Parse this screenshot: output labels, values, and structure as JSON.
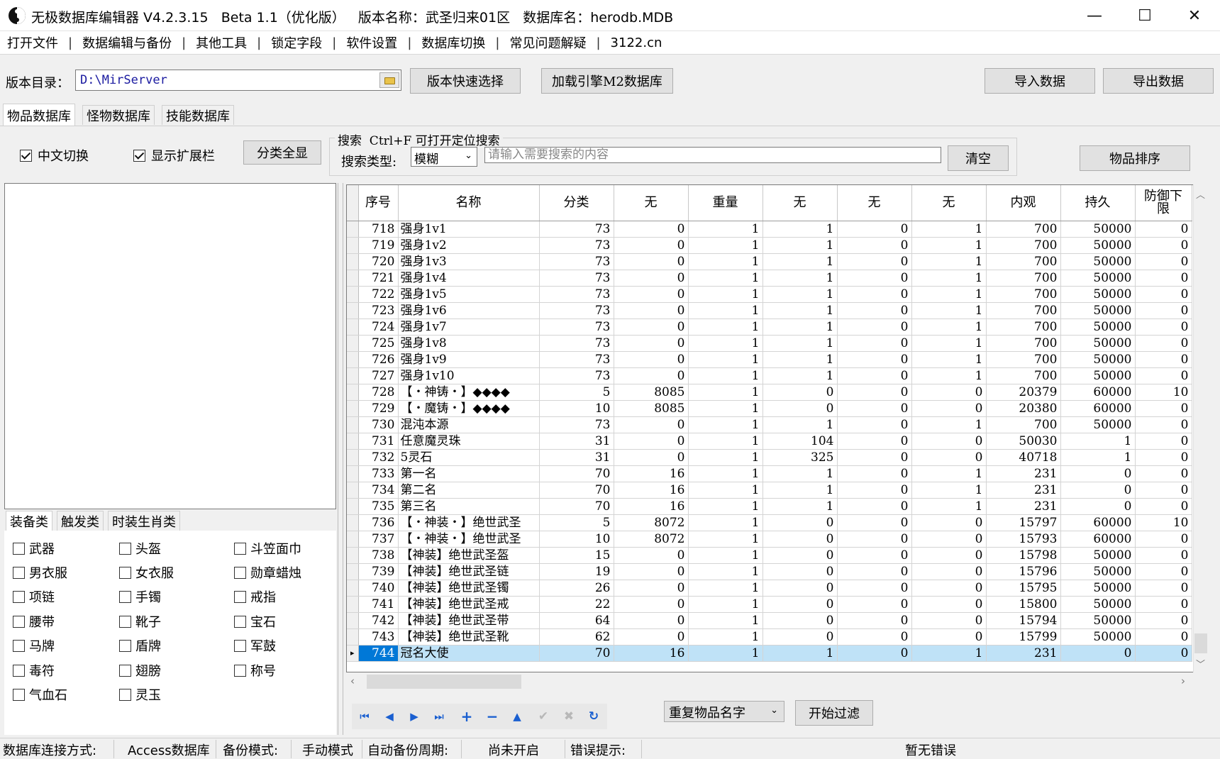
{
  "window": {
    "title": "无极数据库编辑器 V4.2.3.15   Beta 1.1（优化版）   版本名称：武圣归来01区   数据库名：herodb.MDB",
    "minimize": "—",
    "maximize": "☐",
    "close": "✕"
  },
  "menu": [
    "打开文件",
    "数据编辑与备份",
    "其他工具",
    "锁定字段",
    "软件设置",
    "数据库切换",
    "常见问题解疑",
    "3122.cn"
  ],
  "menu_sep": "|",
  "toolbar": {
    "dir_label": "版本目录：",
    "dir_value": "D:\\MirServer",
    "quick_select": "版本快速选择",
    "load_m2": "加载引擎M2数据库",
    "import": "导入数据",
    "export": "导出数据"
  },
  "tabs": [
    "物品数据库",
    "怪物数据库",
    "技能数据库"
  ],
  "filters": {
    "chinese_toggle": "中文切换",
    "chinese_toggle_checked": true,
    "show_ext": "显示扩展栏",
    "show_ext_checked": true,
    "show_all": "分类全显",
    "sort": "物品排序"
  },
  "search": {
    "legend": "搜索  Ctrl+F 可打开定位搜索",
    "type_label": "搜索类型:",
    "type_value": "模糊",
    "placeholder": "请输入需要搜索的内容",
    "clear": "清空"
  },
  "subtabs": [
    "装备类",
    "触发类",
    "时装生肖类"
  ],
  "categories": [
    [
      "武器",
      "头盔",
      "斗笠面巾"
    ],
    [
      "男衣服",
      "女衣服",
      "勋章蜡烛"
    ],
    [
      "项链",
      "手镯",
      "戒指"
    ],
    [
      "腰带",
      "靴子",
      "宝石"
    ],
    [
      "马牌",
      "盾牌",
      "军鼓"
    ],
    [
      "毒符",
      "翅膀",
      "称号"
    ],
    [
      "气血石",
      "灵玉"
    ]
  ],
  "grid": {
    "columns": [
      "序号",
      "名称",
      "分类",
      "无",
      "重量",
      "无",
      "无",
      "无",
      "内观",
      "持久",
      "防御下限"
    ],
    "rows": [
      [
        "718",
        "强身1v1",
        "73",
        "0",
        "1",
        "1",
        "0",
        "1",
        "700",
        "50000",
        "0"
      ],
      [
        "719",
        "强身1v2",
        "73",
        "0",
        "1",
        "1",
        "0",
        "1",
        "700",
        "50000",
        "0"
      ],
      [
        "720",
        "强身1v3",
        "73",
        "0",
        "1",
        "1",
        "0",
        "1",
        "700",
        "50000",
        "0"
      ],
      [
        "721",
        "强身1v4",
        "73",
        "0",
        "1",
        "1",
        "0",
        "1",
        "700",
        "50000",
        "0"
      ],
      [
        "722",
        "强身1v5",
        "73",
        "0",
        "1",
        "1",
        "0",
        "1",
        "700",
        "50000",
        "0"
      ],
      [
        "723",
        "强身1v6",
        "73",
        "0",
        "1",
        "1",
        "0",
        "1",
        "700",
        "50000",
        "0"
      ],
      [
        "724",
        "强身1v7",
        "73",
        "0",
        "1",
        "1",
        "0",
        "1",
        "700",
        "50000",
        "0"
      ],
      [
        "725",
        "强身1v8",
        "73",
        "0",
        "1",
        "1",
        "0",
        "1",
        "700",
        "50000",
        "0"
      ],
      [
        "726",
        "强身1v9",
        "73",
        "0",
        "1",
        "1",
        "0",
        "1",
        "700",
        "50000",
        "0"
      ],
      [
        "727",
        "强身1v10",
        "73",
        "0",
        "1",
        "1",
        "0",
        "1",
        "700",
        "50000",
        "0"
      ],
      [
        "728",
        "【・神铸・】◆◆◆◆",
        "5",
        "8085",
        "1",
        "0",
        "0",
        "0",
        "20379",
        "60000",
        "10"
      ],
      [
        "729",
        "【・魔铸・】◆◆◆◆",
        "10",
        "8085",
        "1",
        "0",
        "0",
        "0",
        "20380",
        "60000",
        "0"
      ],
      [
        "730",
        "混沌本源",
        "73",
        "0",
        "1",
        "1",
        "0",
        "1",
        "700",
        "50000",
        "0"
      ],
      [
        "731",
        "任意魔灵珠",
        "31",
        "0",
        "1",
        "104",
        "0",
        "0",
        "50030",
        "1",
        "0"
      ],
      [
        "732",
        "5灵石",
        "31",
        "0",
        "1",
        "325",
        "0",
        "0",
        "40718",
        "1",
        "0"
      ],
      [
        "733",
        "第一名",
        "70",
        "16",
        "1",
        "1",
        "0",
        "1",
        "231",
        "0",
        "0"
      ],
      [
        "734",
        "第二名",
        "70",
        "16",
        "1",
        "1",
        "0",
        "1",
        "231",
        "0",
        "0"
      ],
      [
        "735",
        "第三名",
        "70",
        "16",
        "1",
        "1",
        "0",
        "1",
        "231",
        "0",
        "0"
      ],
      [
        "736",
        "【・神装・】绝世武圣",
        "5",
        "8072",
        "1",
        "0",
        "0",
        "0",
        "15797",
        "60000",
        "10"
      ],
      [
        "737",
        "【・神装・】绝世武圣",
        "10",
        "8072",
        "1",
        "0",
        "0",
        "0",
        "15793",
        "60000",
        "0"
      ],
      [
        "738",
        "【神装】绝世武圣盔",
        "15",
        "0",
        "1",
        "0",
        "0",
        "0",
        "15798",
        "50000",
        "0"
      ],
      [
        "739",
        "【神装】绝世武圣链",
        "19",
        "0",
        "1",
        "0",
        "0",
        "0",
        "15796",
        "50000",
        "0"
      ],
      [
        "740",
        "【神装】绝世武圣镯",
        "26",
        "0",
        "1",
        "0",
        "0",
        "0",
        "15795",
        "50000",
        "0"
      ],
      [
        "741",
        "【神装】绝世武圣戒",
        "22",
        "0",
        "1",
        "0",
        "0",
        "0",
        "15800",
        "50000",
        "0"
      ],
      [
        "742",
        "【神装】绝世武圣带",
        "64",
        "0",
        "1",
        "0",
        "0",
        "0",
        "15794",
        "50000",
        "0"
      ],
      [
        "743",
        "【神装】绝世武圣靴",
        "62",
        "0",
        "1",
        "0",
        "0",
        "0",
        "15799",
        "50000",
        "0"
      ],
      [
        "744",
        "冠名大使",
        "70",
        "16",
        "1",
        "1",
        "0",
        "1",
        "231",
        "0",
        "0"
      ]
    ],
    "selected_row": "744",
    "row_pointer": "▸"
  },
  "bottom": {
    "nav_icons": [
      "first-icon",
      "prev-icon",
      "next-icon",
      "last-icon",
      "add-icon",
      "delete-icon",
      "up-icon",
      "confirm-icon",
      "cancel-icon",
      "refresh-icon"
    ],
    "filter_select": "重复物品名字",
    "filter_button": "开始过滤"
  },
  "status": {
    "conn_label": "数据库连接方式:",
    "conn_value": "Access数据库",
    "backup_label": "备份模式:",
    "backup_value": "手动模式",
    "auto_label": "自动备份周期:",
    "auto_value": "尚未开启",
    "err_label": "错误提示:",
    "err_value": "暂无错误"
  }
}
